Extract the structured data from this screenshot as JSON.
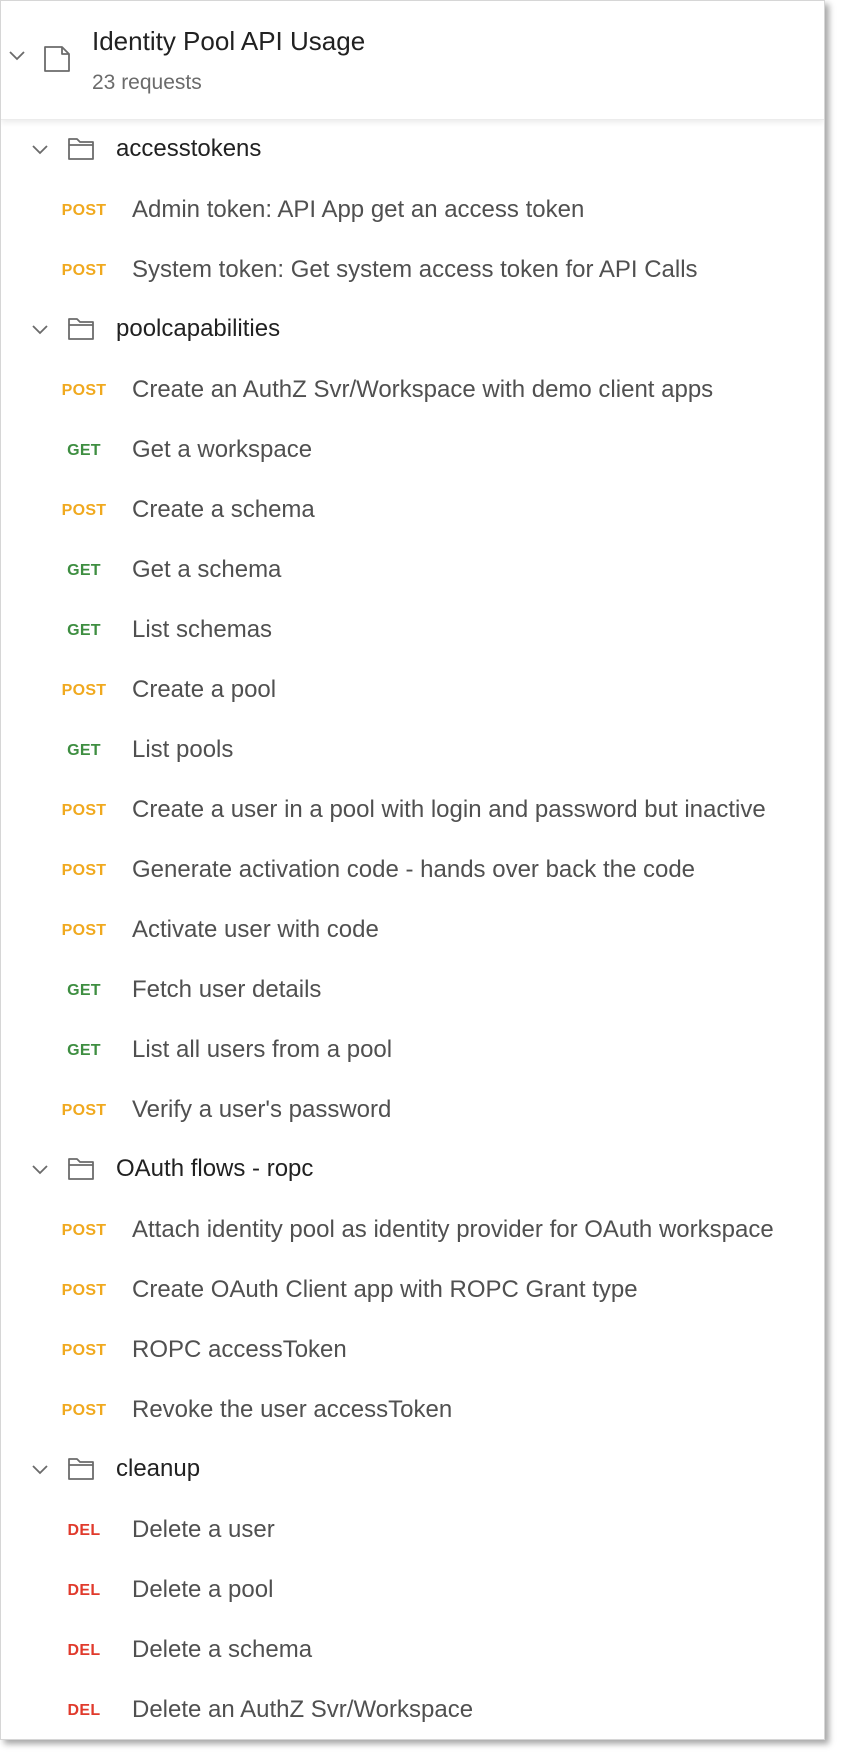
{
  "collection": {
    "title": "Identity Pool API Usage",
    "meta": "23 requests"
  },
  "colors": {
    "POST": "#f0a91f",
    "GET": "#3e8e41",
    "DEL": "#e03a2c"
  },
  "folders": [
    {
      "name": "accesstokens",
      "requests": [
        {
          "method": "POST",
          "name": "Admin token: API App get an access token"
        },
        {
          "method": "POST",
          "name": "System token: Get system access token for API Calls"
        }
      ]
    },
    {
      "name": "poolcapabilities",
      "requests": [
        {
          "method": "POST",
          "name": "Create an AuthZ Svr/Workspace with demo client apps"
        },
        {
          "method": "GET",
          "name": "Get a workspace"
        },
        {
          "method": "POST",
          "name": "Create a schema"
        },
        {
          "method": "GET",
          "name": "Get a schema"
        },
        {
          "method": "GET",
          "name": "List schemas"
        },
        {
          "method": "POST",
          "name": "Create a pool"
        },
        {
          "method": "GET",
          "name": "List pools"
        },
        {
          "method": "POST",
          "name": "Create a user in a pool with login and password but inactive"
        },
        {
          "method": "POST",
          "name": "Generate activation code - hands over back the code"
        },
        {
          "method": "POST",
          "name": "Activate user with code"
        },
        {
          "method": "GET",
          "name": "Fetch user details"
        },
        {
          "method": "GET",
          "name": "List all users from a pool"
        },
        {
          "method": "POST",
          "name": "Verify a user's password"
        }
      ]
    },
    {
      "name": "OAuth flows - ropc",
      "requests": [
        {
          "method": "POST",
          "name": "Attach identity pool as identity provider for OAuth workspace"
        },
        {
          "method": "POST",
          "name": "Create OAuth Client app with ROPC Grant type"
        },
        {
          "method": "POST",
          "name": "ROPC accessToken"
        },
        {
          "method": "POST",
          "name": "Revoke the user accessToken"
        }
      ]
    },
    {
      "name": "cleanup",
      "requests": [
        {
          "method": "DEL",
          "name": "Delete a user"
        },
        {
          "method": "DEL",
          "name": "Delete a pool"
        },
        {
          "method": "DEL",
          "name": "Delete a schema"
        },
        {
          "method": "DEL",
          "name": "Delete an AuthZ Svr/Workspace"
        }
      ]
    }
  ]
}
